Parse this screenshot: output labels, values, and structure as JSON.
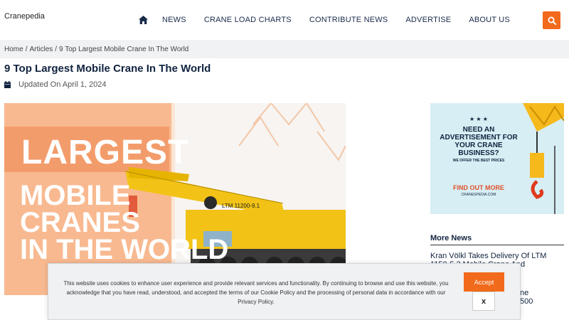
{
  "site": {
    "logo": "Cranepedia"
  },
  "nav": {
    "items": [
      "NEWS",
      "CRANE LOAD CHARTS",
      "CONTRIBUTE NEWS",
      "ADVERTISE",
      "ABOUT US"
    ]
  },
  "breadcrumb": {
    "home": "Home",
    "articles": "Articles",
    "current": "9 Top Largest Mobile Crane In The World",
    "separator": "/"
  },
  "article": {
    "title": "9 Top Largest Mobile Crane In The World",
    "updated": "Updated On April 1, 2024"
  },
  "hero": {
    "lines": [
      "LARGEST",
      "MOBILE",
      "CRANES",
      "IN THE WORLD"
    ],
    "crane_model": "LTM 11200-9.1"
  },
  "ad": {
    "stars": "★ ★ ★",
    "headline": "NEED AN ADVERTISEMENT FOR YOUR CRANE BUSINESS?",
    "sub": "WE OFFER THE BEST PRICES",
    "cta": "FIND OUT MORE",
    "site": "CRANESPEDIA.COM"
  },
  "more_news": {
    "heading": "More News",
    "items": [
      "Kran Völkl Takes Delivery Of LTM 1150-5.3 Mobile Crane And",
      "ne",
      "500"
    ]
  },
  "cookie": {
    "text": "This website uses cookies to enhance user experience and provide relevant services and functionality. By continuing to browse and use this website, you acknowledge that you have read, understood, and accepted the terms of our Cookie Policy and the processing of personal data in accordance with our Privacy Policy.",
    "accept": "Accept",
    "close": "x"
  },
  "colors": {
    "accent": "#f26a1b",
    "title": "#10233f",
    "hero_bg": "#fbe6d6",
    "ad_bg": "#d7eef4"
  },
  "icons": {
    "home": "home-icon",
    "search": "search-icon",
    "calendar": "calendar-icon"
  }
}
